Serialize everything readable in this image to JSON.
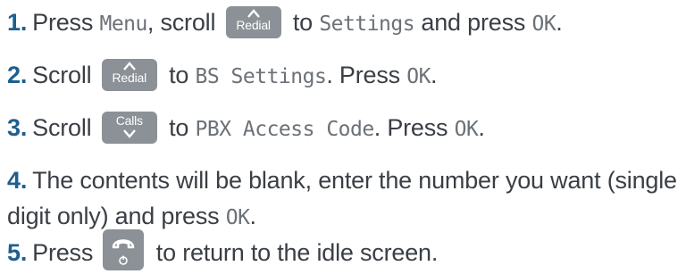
{
  "steps": [
    {
      "number": "1",
      "parts": {
        "a": "Press ",
        "lcd1": "Menu",
        "b": ", scroll ",
        "key": "Redial",
        "c": " to ",
        "lcd2": "Settings",
        "d": " and press ",
        "lcd3": "OK",
        "e": "."
      }
    },
    {
      "number": "2",
      "parts": {
        "a": "Scroll ",
        "key": "Redial",
        "b": " to ",
        "lcd1": "BS Settings",
        "c": ". Press ",
        "lcd2": "OK",
        "d": "."
      }
    },
    {
      "number": "3",
      "parts": {
        "a": "Scroll ",
        "key": "Calls",
        "b": " to ",
        "lcd1": "PBX Access Code",
        "c": ". Press ",
        "lcd2": "OK",
        "d": "."
      }
    },
    {
      "number": "4",
      "parts": {
        "a": "The contents will be blank, enter the number you want (single digit only) and press ",
        "lcd1": "OK",
        "b": "."
      }
    },
    {
      "number": "5",
      "parts": {
        "a": "Press ",
        "key_icon": "end-call-icon",
        "b": " to return to the idle screen."
      }
    }
  ],
  "colors": {
    "number": "#1d5f8f",
    "text": "#3a3f45",
    "key_bg": "#8b9196",
    "lcd_text": "#6b7177"
  }
}
